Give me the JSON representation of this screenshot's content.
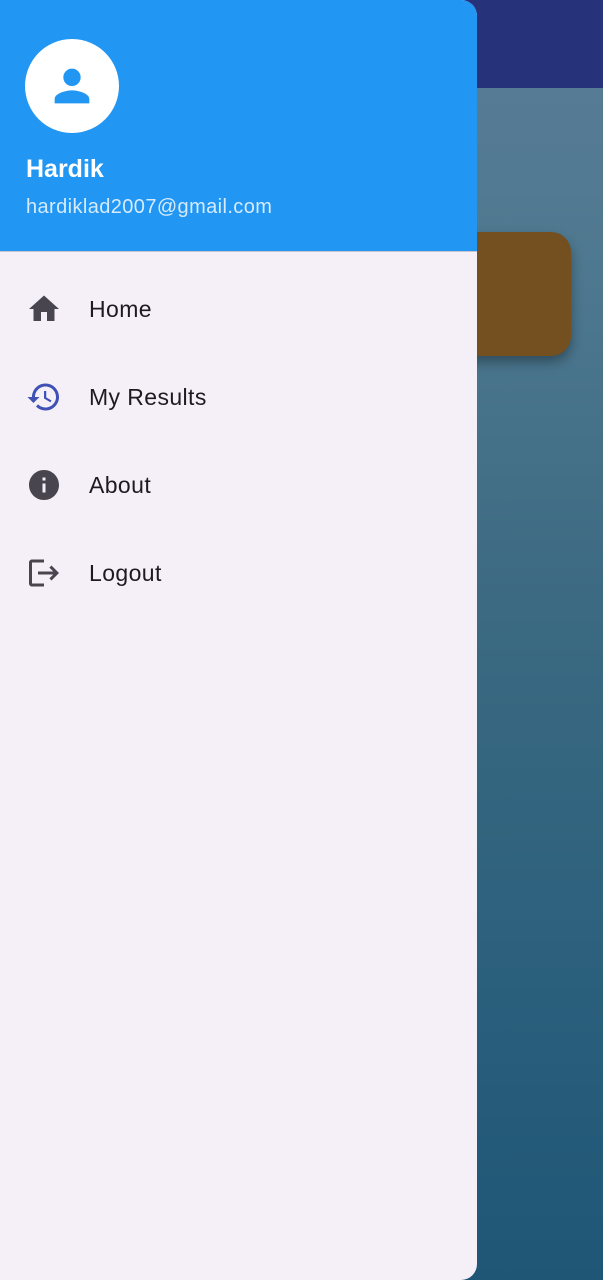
{
  "account": {
    "name": "Hardik",
    "email": "hardiklad2007@gmail.com",
    "avatar_icon": "person-icon"
  },
  "menu": {
    "items": [
      {
        "label": "Home",
        "icon": "home-icon"
      },
      {
        "label": "My Results",
        "icon": "history-icon"
      },
      {
        "label": "About",
        "icon": "info-icon"
      },
      {
        "label": "Logout",
        "icon": "logout-icon"
      }
    ]
  },
  "colors": {
    "header": "#2196f3",
    "drawer_bg": "#f5eff7",
    "app_bar": "#26327a",
    "card": "#744f1f",
    "icon": "#49454f",
    "history_icon": "#3f51b5"
  }
}
